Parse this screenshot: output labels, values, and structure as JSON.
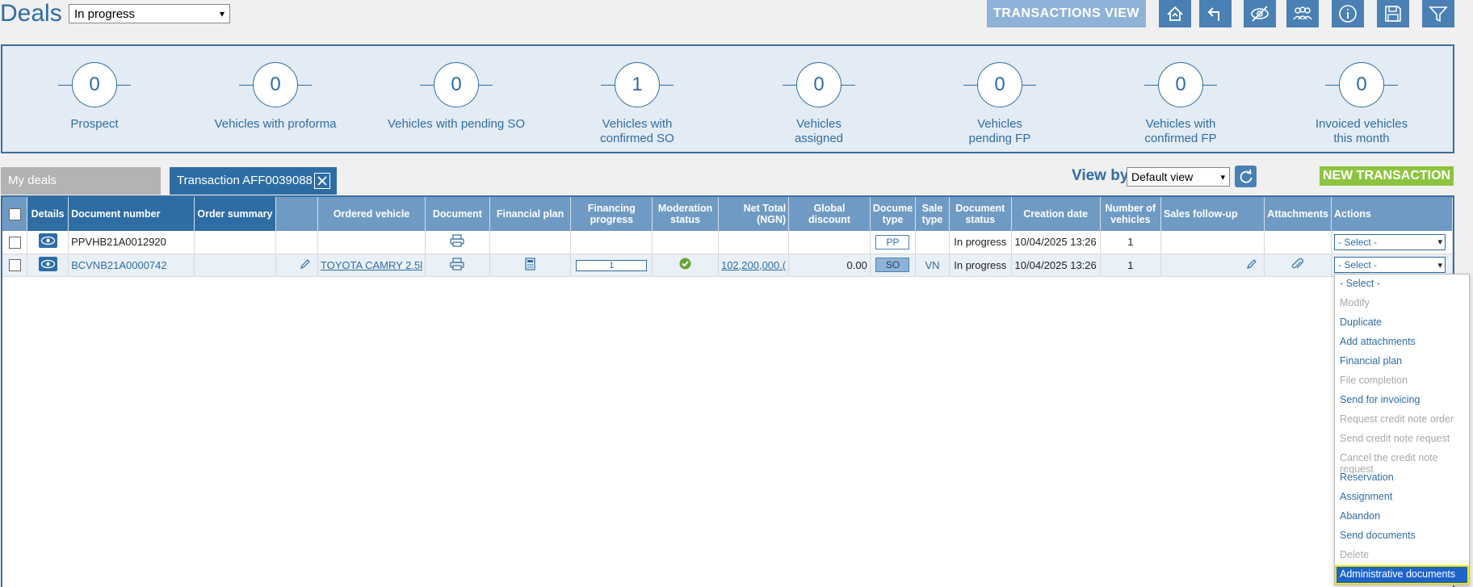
{
  "header": {
    "title": "Deals",
    "status_filter": "In progress",
    "transactions_view_label": "TRANSACTIONS VIEW",
    "tools": [
      "home-up-icon",
      "back-arrow-icon",
      "hide-icon",
      "group-icon",
      "info-icon",
      "save-icon",
      "filter-icon"
    ]
  },
  "kpis": [
    {
      "value": "0",
      "label": "Prospect"
    },
    {
      "value": "0",
      "label": "Vehicles with proforma"
    },
    {
      "value": "0",
      "label": "Vehicles with pending SO"
    },
    {
      "value": "1",
      "label": "Vehicles with confirmed SO"
    },
    {
      "value": "0",
      "label": "Vehicles assigned"
    },
    {
      "value": "0",
      "label": "Vehicles pending FP"
    },
    {
      "value": "0",
      "label": "Vehicles with confirmed FP"
    },
    {
      "value": "0",
      "label": "Invoiced vehicles this month"
    }
  ],
  "tabs": {
    "my_deals": "My deals",
    "transaction": "Transaction AFF0039088"
  },
  "view_by": {
    "label": "View by",
    "value": "Default view"
  },
  "new_transaction_label": "NEW TRANSACTION",
  "table": {
    "headers": {
      "details": "Details",
      "document_number": "Document number",
      "order_summary": "Order summary",
      "ordered_vehicle": "Ordered vehicle",
      "document": "Document",
      "financial_plan": "Financial plan",
      "financing_progress": "Financing progress",
      "moderation_status": "Moderation status",
      "net_total": "Net Total (NGN)",
      "global_discount": "Global discount",
      "document_type": "Docume type",
      "sale_type": "Sale type",
      "document_status": "Document status",
      "creation_date": "Creation date",
      "number_of_vehicles": "Number of vehicles",
      "sales_followup": "Sales follow-up",
      "attachments": "Attachments",
      "actions": "Actions"
    },
    "rows": [
      {
        "document_number": "PPVHB21A0012920",
        "ordered_vehicle": "",
        "financing_progress": "",
        "net_total": "",
        "global_discount": "",
        "document_type": "PP",
        "sale_type": "",
        "document_status": "In progress",
        "creation_date": "10/04/2025 13:26",
        "number_of_vehicles": "1",
        "action": "- Select -"
      },
      {
        "document_number": "BCVNB21A0000742",
        "ordered_vehicle": "TOYOTA CAMRY 2.5l",
        "financing_progress": "1",
        "net_total": "102,200,000.(",
        "global_discount": "0.00",
        "document_type": "SO",
        "sale_type": "VN",
        "document_status": "In progress",
        "creation_date": "10/04/2025 13:26",
        "number_of_vehicles": "1",
        "action": "- Select -"
      }
    ]
  },
  "actions_menu": [
    {
      "label": "- Select -",
      "state": "default"
    },
    {
      "label": "Modify",
      "state": "disabled"
    },
    {
      "label": "Duplicate",
      "state": "enabled"
    },
    {
      "label": "Add attachments",
      "state": "enabled"
    },
    {
      "label": "Financial plan",
      "state": "enabled"
    },
    {
      "label": "File completion",
      "state": "disabled"
    },
    {
      "label": "Send for invoicing",
      "state": "enabled"
    },
    {
      "label": "Request credit note order",
      "state": "disabled"
    },
    {
      "label": "Send credit note request",
      "state": "disabled"
    },
    {
      "label": "Cancel the credit note request",
      "state": "disabled"
    },
    {
      "label": "Reservation",
      "state": "enabled"
    },
    {
      "label": "Assignment",
      "state": "enabled"
    },
    {
      "label": "Abandon",
      "state": "enabled"
    },
    {
      "label": "Send documents",
      "state": "enabled"
    },
    {
      "label": "Delete",
      "state": "disabled"
    },
    {
      "label": "Administrative documents",
      "state": "highlighted"
    }
  ],
  "colors": {
    "brand_blue": "#2e6da4",
    "header_blue": "#6f9ac4",
    "new_button_green": "#8dc43f",
    "panel_bg": "#e3ebf4"
  }
}
